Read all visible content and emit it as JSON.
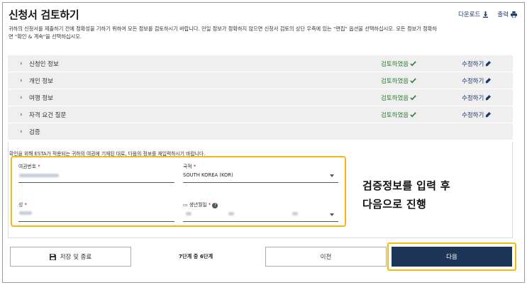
{
  "header": {
    "title": "신청서 검토하기",
    "description": "귀하의 신청서를 제출하기 전에 정확성을 기하기 위하여 모든 정보를 검토하시기 바랍니다. 만일 정보가 정확하지 않으면 신청서 검토의 상단 우측에 있는 \"편집\" 옵션을 선택하십시오. 모든 정보가 정확하면 \"확인 & 계속\"을 선택하십시오.",
    "download_label": "다운로드",
    "print_label": "출력"
  },
  "sections": [
    {
      "name": "신청인 정보",
      "status": "검토하였음",
      "edit": "수정하기"
    },
    {
      "name": "개인 정보",
      "status": "검토하였음",
      "edit": "수정하기"
    },
    {
      "name": "여행 정보",
      "status": "검토하였음",
      "edit": "수정하기"
    },
    {
      "name": "자격 요건 질문",
      "status": "검토하였음",
      "edit": "수정하기"
    },
    {
      "name": "검증"
    }
  ],
  "verification": {
    "note": "확인을 위해 ESTA가 적용되는 귀하의 여권에 기재된 대로, 다음의 정보를 재입력하시기 바랍니다.",
    "passport_label": "여권번호",
    "country_label": "국적",
    "country_value": "SOUTH KOREA (KOR)",
    "surname_label": "성",
    "dob_label": "생년월일",
    "required_mark": "*"
  },
  "callout": {
    "line1": "검증정보를 입력 후",
    "line2": "다음으로 진행"
  },
  "footer": {
    "save_label": "저장 및 종료",
    "step_text": "7단계 중 6단계",
    "prev_label": "이전",
    "next_label": "다음"
  },
  "colors": {
    "accent_navy": "#1d3557",
    "check_green": "#2e7d32",
    "highlight_yellow": "#f2b90f"
  }
}
